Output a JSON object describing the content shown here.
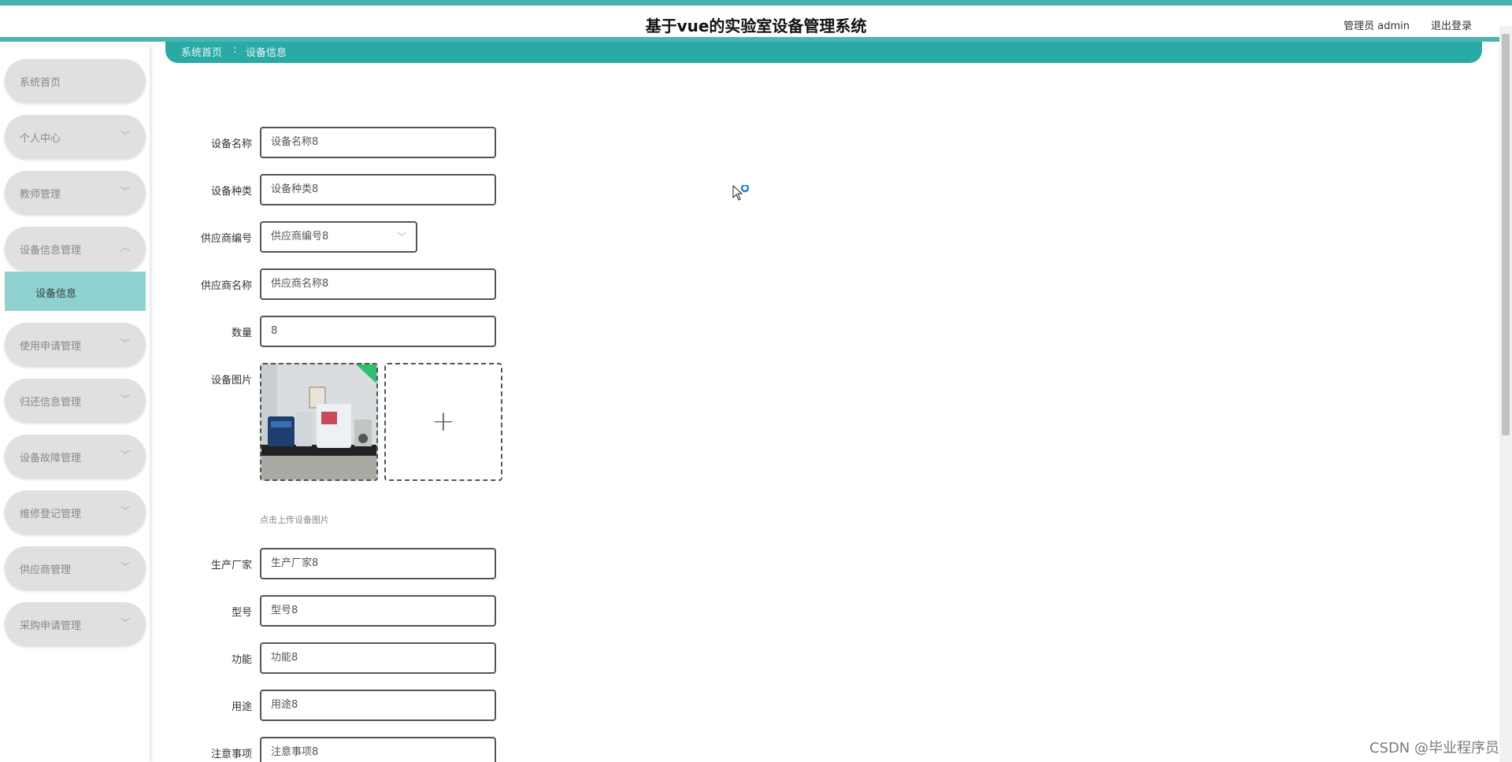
{
  "header": {
    "title": "基于vue的实验室设备管理系统",
    "user": "管理员 admin",
    "logout": "退出登录"
  },
  "breadcrumb": {
    "home": "系统首页",
    "sep": ":",
    "current": "设备信息"
  },
  "sidebar": {
    "items": [
      {
        "label": "系统首页"
      },
      {
        "label": "个人中心"
      },
      {
        "label": "教师管理"
      },
      {
        "label": "设备信息管理"
      },
      {
        "label": "使用申请管理"
      },
      {
        "label": "归还信息管理"
      },
      {
        "label": "设备故障管理"
      },
      {
        "label": "维修登记管理"
      },
      {
        "label": "供应商管理"
      },
      {
        "label": "采购申请管理"
      }
    ],
    "subitem": "设备信息"
  },
  "form": {
    "name_label": "设备名称",
    "name_value": "设备名称8",
    "type_label": "设备种类",
    "type_value": "设备种类8",
    "supplier_no_label": "供应商编号",
    "supplier_no_value": "供应商编号8",
    "supplier_name_label": "供应商名称",
    "supplier_name_value": "供应商名称8",
    "qty_label": "数量",
    "qty_value": "8",
    "image_label": "设备图片",
    "image_hint": "点击上传设备图片",
    "maker_label": "生产厂家",
    "maker_value": "生产厂家8",
    "model_label": "型号",
    "model_value": "型号8",
    "func_label": "功能",
    "func_value": "功能8",
    "use_label": "用途",
    "use_value": "用途8",
    "note_label": "注意事项",
    "note_value": "注意事项8"
  },
  "icons": {
    "upload": "+",
    "chevron": "﹀"
  },
  "watermark": "CSDN @毕业程序员",
  "colors": {
    "accent": "#2aaaa6",
    "header_stripe": "#45b1ad",
    "active_submenu": "#8fd1d1"
  }
}
